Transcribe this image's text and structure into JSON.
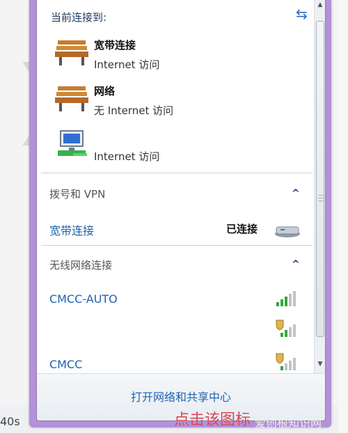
{
  "panel": {
    "title": "当前连接到:",
    "connections": [
      {
        "name": "宽带连接",
        "status": "Internet 访问"
      },
      {
        "name": "网络",
        "status": "无 Internet 访问"
      },
      {
        "name": "",
        "status": "Internet 访问"
      }
    ],
    "dialup_section": {
      "title": "拨号和 VPN",
      "item_name": "宽带连接",
      "item_status": "已连接"
    },
    "wireless_section": {
      "title": "无线网络连接",
      "networks": [
        {
          "name": "CMCC-AUTO",
          "secured": false
        },
        {
          "name": "",
          "secured": true
        },
        {
          "name": "CMCC",
          "secured": true
        }
      ]
    },
    "footer_link": "打开网络和共享中心"
  },
  "background": {
    "left_time_fragment": "40s",
    "bottom_annotation": "点击该图标",
    "corner_watermark": "爱创根知识网"
  },
  "colors": {
    "accent": "#1b63b1",
    "frame": "#b491d8",
    "annotation": "#d94a5c"
  },
  "icons": {
    "refresh": "refresh-icon",
    "wired": "network-bench-icon",
    "lan": "computer-network-icon",
    "modem": "modem-icon",
    "signal": "wifi-signal-icon",
    "shield": "security-shield-icon"
  }
}
